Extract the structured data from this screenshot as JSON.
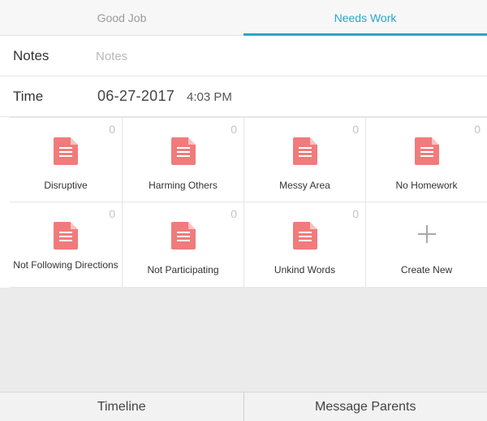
{
  "tabs": [
    {
      "label": "Good Job",
      "active": false
    },
    {
      "label": "Needs Work",
      "active": true
    }
  ],
  "notes": {
    "label": "Notes",
    "placeholder": "Notes",
    "value": ""
  },
  "time": {
    "label": "Time",
    "date": "06-27-2017",
    "clock": "4:03 PM"
  },
  "behaviors": [
    {
      "label": "Disruptive",
      "count": "0",
      "icon": "document-icon"
    },
    {
      "label": "Harming Others",
      "count": "0",
      "icon": "document-icon"
    },
    {
      "label": "Messy Area",
      "count": "0",
      "icon": "document-icon"
    },
    {
      "label": "No Homework",
      "count": "0",
      "icon": "document-icon"
    },
    {
      "label": "Not Following Directions",
      "count": "0",
      "icon": "document-icon"
    },
    {
      "label": "Not Participating",
      "count": "0",
      "icon": "document-icon"
    },
    {
      "label": "Unkind Words",
      "count": "0",
      "icon": "document-icon"
    }
  ],
  "create_new": {
    "label": "Create New",
    "icon": "plus-icon"
  },
  "bottom_bar": {
    "timeline": "Timeline",
    "message_parents": "Message Parents"
  },
  "colors": {
    "accent": "#2aa6c8",
    "icon": "#f17b7b",
    "background_gray": "#ebebeb"
  }
}
